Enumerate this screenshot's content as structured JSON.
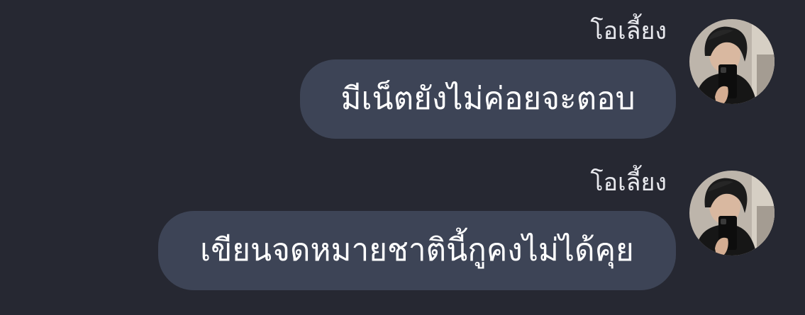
{
  "messages": [
    {
      "sender": "โอเลี้ยง",
      "text": "มีเน็ตยังไม่ค่อยจะตอบ",
      "avatar": "profile-photo"
    },
    {
      "sender": "โอเลี้ยง",
      "text": "เขียนจดหมายชาตินี้กูคงไม่ได้คุย",
      "avatar": "profile-photo"
    }
  ],
  "colors": {
    "background": "#262832",
    "bubble": "#3d4456",
    "text": "#ffffff",
    "sender": "#e8e9ee"
  }
}
